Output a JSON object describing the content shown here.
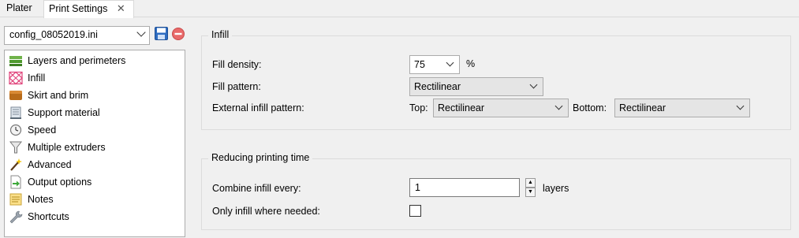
{
  "tabs": {
    "plater": "Plater",
    "print_settings": "Print Settings",
    "close_glyph": "✕"
  },
  "preset": {
    "selected": "config_08052019.ini",
    "icons": [
      "save-icon",
      "delete-icon"
    ]
  },
  "sidebar": {
    "items": [
      {
        "label": "Layers and perimeters",
        "icon": "layers-icon"
      },
      {
        "label": "Infill",
        "icon": "infill-icon"
      },
      {
        "label": "Skirt and brim",
        "icon": "skirt-brim-icon"
      },
      {
        "label": "Support material",
        "icon": "support-material-icon"
      },
      {
        "label": "Speed",
        "icon": "speed-icon"
      },
      {
        "label": "Multiple extruders",
        "icon": "funnel-icon"
      },
      {
        "label": "Advanced",
        "icon": "wand-icon"
      },
      {
        "label": "Output options",
        "icon": "output-icon"
      },
      {
        "label": "Notes",
        "icon": "notes-icon"
      },
      {
        "label": "Shortcuts",
        "icon": "wrench-icon"
      }
    ]
  },
  "infill": {
    "title": "Infill",
    "fill_density_label": "Fill density:",
    "fill_density_value": "75",
    "fill_density_unit": "%",
    "fill_pattern_label": "Fill pattern:",
    "fill_pattern_value": "Rectilinear",
    "external_label": "External infill pattern:",
    "top_label": "Top:",
    "top_value": "Rectilinear",
    "bottom_label": "Bottom:",
    "bottom_value": "Rectilinear"
  },
  "reducing": {
    "title": "Reducing printing time",
    "combine_label": "Combine infill every:",
    "combine_value": "1",
    "combine_unit": "layers",
    "only_needed_label": "Only infill where needed:",
    "only_needed_checked": false
  },
  "colors": {
    "background": "#f0f0f0",
    "save_blue": "#2e6cc0",
    "delete_red": "#e86a6a"
  }
}
